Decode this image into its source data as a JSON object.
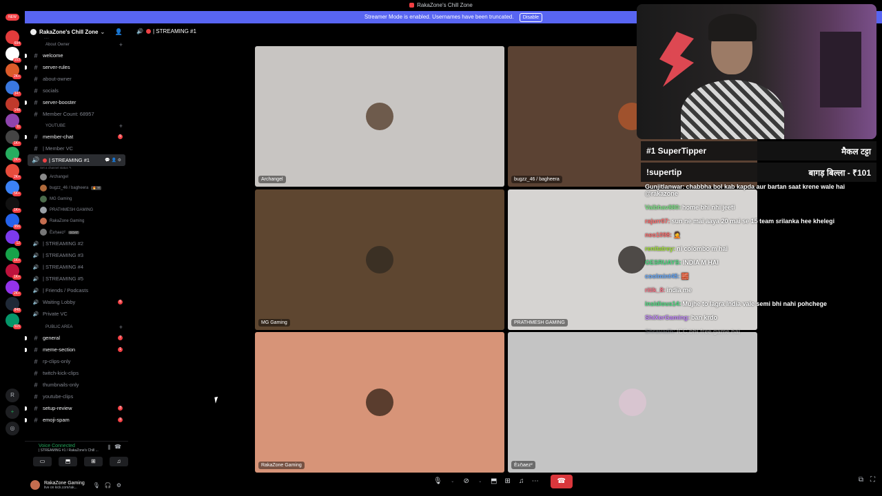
{
  "topbar": {
    "title": "RakaZone's Chill Zone"
  },
  "banner": {
    "text": "Streamer Mode is enabled. Usernames have been truncated.",
    "disable_label": "Disable"
  },
  "rail": {
    "new_label": "NEW",
    "r_label": "R",
    "badges": [
      "694",
      "153",
      "2K+",
      "347",
      "148",
      "11",
      "1K+",
      "2K+",
      "2K+",
      "5K+",
      "1K+",
      "956",
      "12",
      "1K+",
      "1K+",
      "2K+",
      "848",
      "515"
    ]
  },
  "server": {
    "name": "RakaZone's Chill Zone",
    "truncated_label": "....."
  },
  "categories": {
    "about_owner": "About Owner",
    "youtube": "YOUTUBE",
    "public_area": "PUBLIC AREA"
  },
  "channels_about": [
    {
      "label": "welcome",
      "unread": true
    },
    {
      "label": "server-rules",
      "unread": true
    },
    {
      "label": "about-owner",
      "unread": false
    },
    {
      "label": "socials",
      "unread": false
    },
    {
      "label": "server-booster",
      "unread": true
    },
    {
      "label": "Member Count: 68957",
      "unread": false
    }
  ],
  "channels_youtube": [
    {
      "label": "member-chat",
      "unread": true,
      "count": "5"
    },
    {
      "label": "| Member VC",
      "unread": false
    }
  ],
  "active_channel": {
    "label": "| STREAMING #1",
    "status": "Set a channel status ✎"
  },
  "voice_members": [
    {
      "name": "Archangel",
      "tag": ""
    },
    {
      "name": "bugzz_46 / bagheera",
      "tag": "🔥 ✉"
    },
    {
      "name": "MG Gaming",
      "tag": ""
    },
    {
      "name": "PRATHMESH GAMING",
      "tag": ""
    },
    {
      "name": "RakaZone Gaming",
      "tag": ""
    },
    {
      "name": "Ѐ϶ℌaez²",
      "tag": "GOAT"
    }
  ],
  "voice_channels": [
    {
      "label": "| STREAMING #2"
    },
    {
      "label": "| STREAMING #3"
    },
    {
      "label": "| STREAMING #4"
    },
    {
      "label": "| STREAMING #5"
    },
    {
      "label": "| Friends / Podcasts"
    },
    {
      "label": "Waiting Lobby",
      "count": "6"
    },
    {
      "label": "Private VC"
    }
  ],
  "channels_public": [
    {
      "label": "general",
      "unread": true,
      "count": "7"
    },
    {
      "label": "meme-section",
      "unread": true,
      "count": "1"
    },
    {
      "label": "rp-clips-only",
      "unread": false
    },
    {
      "label": "twitch-kick-clips",
      "unread": false
    },
    {
      "label": "thumbnails-only",
      "unread": false
    },
    {
      "label": "youtube-clips",
      "unread": false
    },
    {
      "label": "setup-review",
      "unread": true,
      "count": "3"
    },
    {
      "label": "emoji-spam",
      "unread": true,
      "count": "3"
    }
  ],
  "voice_panel": {
    "status": "Voice Connected",
    "sub": "| STREAMING #1 / RakaZone's Chill ..."
  },
  "user_panel": {
    "name": "RakaZone Gaming",
    "status": "live on kick.com/rak..."
  },
  "main": {
    "channel_title": "| STREAMING #1"
  },
  "tiles": [
    {
      "name": "Archangel",
      "bg": "#c8c5c2"
    },
    {
      "name": "bugzz_46 / bagheera",
      "bg": "#5b4233"
    },
    {
      "name": "MG Gaming",
      "bg": "#5e4630"
    },
    {
      "name": "PRATHMESH GAMING",
      "bg": "#d6d4d2"
    },
    {
      "name": "RakaZone Gaming",
      "bg": "#d79478"
    },
    {
      "name": "Ѐ϶ℌaez²",
      "bg": "#c4c4c4"
    }
  ],
  "tips": {
    "row1_left": "#1 SuperTipper",
    "row1_right": "मैकल टट्टा",
    "row2_left": "!supertip",
    "row2_right": "बागड़ बिल्ला - ₹101"
  },
  "chat": [
    {
      "user": "Gunjitlanwar:",
      "text": "chabbha bol kab kapda aur bartan saat krene wale hai @rakazone",
      "color": "#ffffff"
    },
    {
      "user": "Vaibhav880:",
      "text": "home bhi nhi jeeti",
      "color": "#7ee787"
    },
    {
      "user": "rajurr07:",
      "text": "sun ne mai aaya 20 mai se 15 team srilanka hee khelegi",
      "color": "#ff6b6b"
    },
    {
      "user": "neo1098:",
      "text": "🤦",
      "color": "#ff6b6b"
    },
    {
      "user": "renitatrey:",
      "text": "ni colombo m hai",
      "color": "#a3e635"
    },
    {
      "user": "GESRUAYS:",
      "text": "INDIA M HAI",
      "color": "#4ade80"
    },
    {
      "user": "coolmint45:",
      "text": "🧱",
      "color": "#60a5fa"
    },
    {
      "user": "ritik_8:",
      "text": "india me",
      "color": "#fb7185"
    },
    {
      "user": "insidious14:",
      "text": "Mujhe to lagra India vale semi bhi nahi pohchege",
      "color": "#4ade80"
    },
    {
      "user": "ShiXerGaming:",
      "text": "ban krdo",
      "color": "#c084fc"
    },
    {
      "user": "Shravadh:",
      "text": "ICC bhi free game hai",
      "color": "#9ca3af"
    }
  ],
  "colors": {
    "accent": "#5865f2",
    "danger": "#da373c",
    "online": "#23a55a"
  }
}
